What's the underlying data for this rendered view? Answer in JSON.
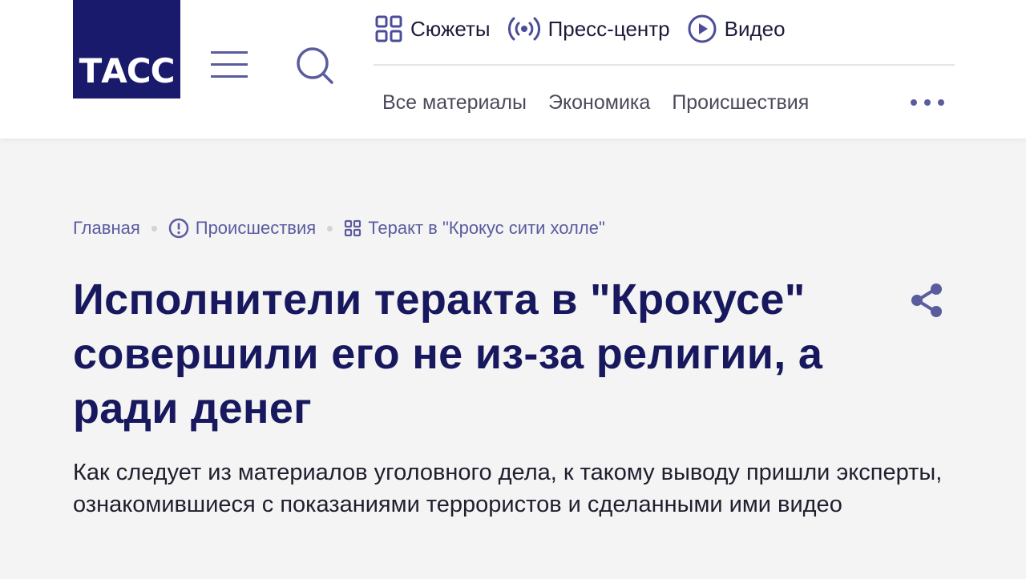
{
  "logo": {
    "text": "ТАСС"
  },
  "header": {
    "top_nav": [
      {
        "label": "Сюжеты",
        "icon": "grid-icon"
      },
      {
        "label": "Пресс-центр",
        "icon": "broadcast-icon"
      },
      {
        "label": "Видео",
        "icon": "play-icon"
      }
    ],
    "categories": [
      "Все материалы",
      "Экономика",
      "Происшествия"
    ],
    "more_icon": "more-dots-icon"
  },
  "breadcrumb": [
    {
      "label": "Главная"
    },
    {
      "label": "Происшествия",
      "icon": "alert-circle-icon"
    },
    {
      "label": "Теракт в \"Крокус сити холле\"",
      "icon": "grid-icon"
    }
  ],
  "article": {
    "title": "Исполнители теракта в \"Крокусе\" совершили его не из-за религии, а ради денег",
    "lead": "Как следует из материалов уголовного дела, к такому выводу пришли эксперты, ознакомившиеся с показаниями террористов и сделанными ими видео"
  },
  "colors": {
    "brand": "#1a1a6c",
    "accent": "#5a5c9e",
    "background": "#f4f4f5"
  }
}
